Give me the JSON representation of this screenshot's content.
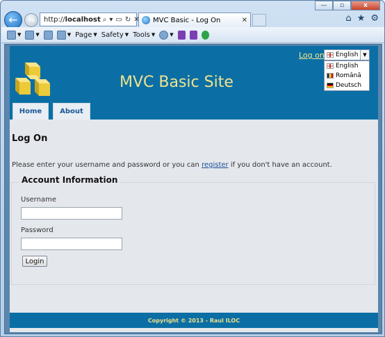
{
  "browser": {
    "address": {
      "prefix": "http://",
      "host": "localhost"
    },
    "tab": {
      "title": "MVC Basic - Log On"
    },
    "window_controls": [
      "—",
      "▫",
      "x"
    ],
    "commands": [
      {
        "label": "Page"
      },
      {
        "label": "Safety"
      },
      {
        "label": "Tools"
      }
    ]
  },
  "site": {
    "title": "MVC Basic Site",
    "logon_link": "Log on",
    "language": {
      "selected": "English",
      "options": [
        "English",
        "Română",
        "Deutsch"
      ]
    },
    "menu": [
      "Home",
      "About"
    ]
  },
  "logon": {
    "heading": "Log On",
    "intro_before": "Please enter your username and password or you can ",
    "intro_link": "register",
    "intro_after": " if you don't have an account.",
    "legend": "Account Information",
    "username_label": "Username",
    "password_label": "Password",
    "login_button": "Login"
  },
  "footer": {
    "text": "Copyright © 2013 - Raul ILOC"
  },
  "colors": {
    "header": "#0b6fa5",
    "title": "#f1e28e",
    "page_bg": "#e4e7ec"
  }
}
